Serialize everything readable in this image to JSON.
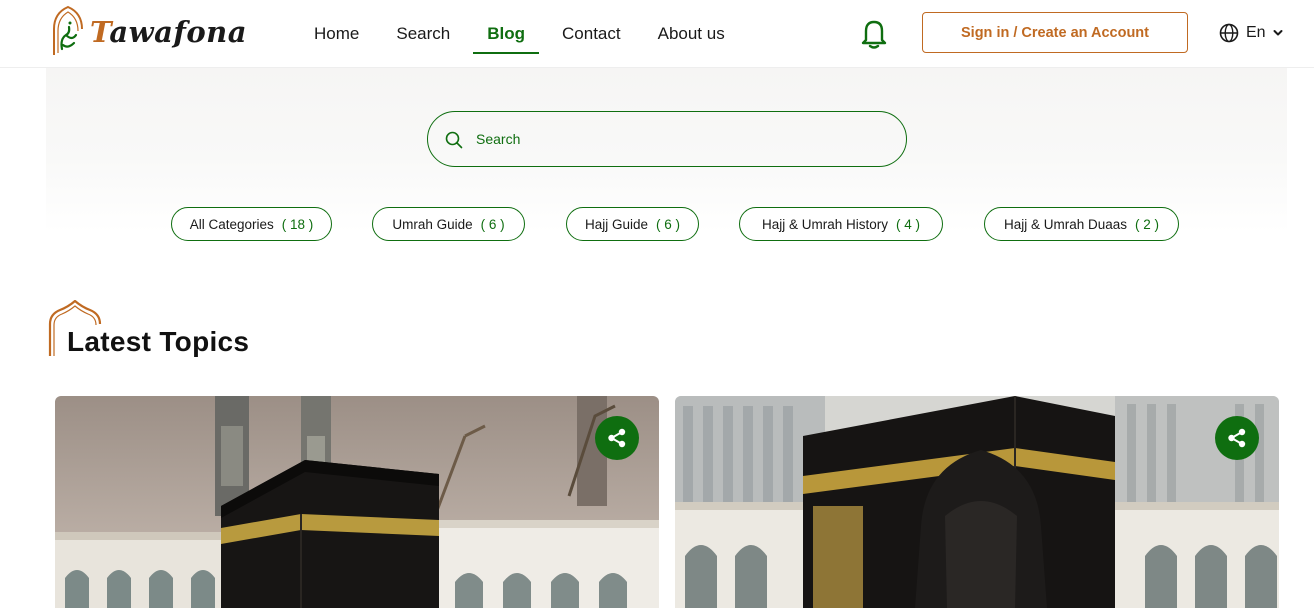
{
  "brand": {
    "name": "Tawafona",
    "initial": "T",
    "rest": "awafona"
  },
  "nav": {
    "items": [
      {
        "label": "Home",
        "active": false
      },
      {
        "label": "Search",
        "active": false
      },
      {
        "label": "Blog",
        "active": true
      },
      {
        "label": "Contact",
        "active": false
      },
      {
        "label": "About us",
        "active": false
      }
    ]
  },
  "header": {
    "notification_icon": "bell-icon",
    "signin_label": "Sign in / Create an Account",
    "language": "En",
    "language_icon": "globe-icon",
    "language_caret_icon": "chevron-down-icon"
  },
  "search": {
    "placeholder": "Search",
    "icon": "search-icon"
  },
  "categories": [
    {
      "label": "All Categories",
      "count": "( 18 )"
    },
    {
      "label": "Umrah Guide",
      "count": "( 6 )"
    },
    {
      "label": "Hajj Guide",
      "count": "( 6 )"
    },
    {
      "label": "Hajj & Umrah History",
      "count": "( 4 )"
    },
    {
      "label": "Hajj & Umrah Duaas",
      "count": "( 2 )"
    }
  ],
  "section": {
    "title": "Latest Topics",
    "icon": "dome-arch-icon"
  },
  "cards": [
    {
      "image": "kaaba-night-photo",
      "share_icon": "share-icon"
    },
    {
      "image": "kaaba-pilgrim-photo",
      "share_icon": "share-icon"
    }
  ],
  "colors": {
    "primary": "#0f6e10",
    "accent": "#c06a22",
    "text": "#1a1a1a"
  }
}
